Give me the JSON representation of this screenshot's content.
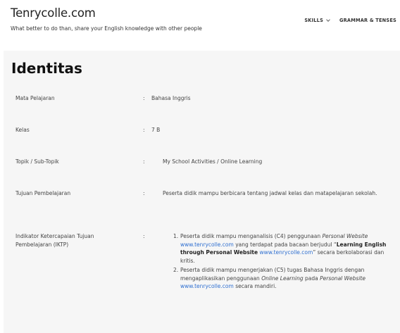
{
  "header": {
    "site_title": "Tenrycolle.com",
    "tagline": "What better to do than, share your English knowledge with other people",
    "nav": [
      {
        "label": "SKILLS"
      },
      {
        "label": "GRAMMAR & TENSES"
      }
    ]
  },
  "main": {
    "heading": "Identitas",
    "separator": ":",
    "rows": [
      {
        "label": "Mata Pelajaran",
        "value": "Bahasa Inggris"
      },
      {
        "label": "Kelas",
        "value": "7 B"
      },
      {
        "label": "Topik / Sub-Topik",
        "value": "My School Activities / Online Learning"
      },
      {
        "label": "Tujuan Pembelajaran",
        "value": "Peserta didik mampu berbicara tentang jadwal kelas dan matapelajaran sekolah."
      },
      {
        "label": "Indikator Ketercapaian Tujuan Pembelajaran (IKTP)"
      }
    ],
    "iktp": [
      {
        "num": "1.",
        "p1": "Peserta didik mampu menganalisis  (C4) penggunaan ",
        "i1": "Personal Website",
        "p2": " ",
        "link1": "www.tenrycolle.com",
        "p3": " yang terdapat pada bacaan berjudul “",
        "bold": "Learning English through Personal Website",
        "p4": " ",
        "link2": "www.tenrycolle.com",
        "p5": "” secara berkolaborasi dan kritis."
      },
      {
        "num": "2.",
        "p1": "Peserta didik mampu mengerjakan (C5) tugas Bahasa Inggris dengan mengaplikasikan penggunaan ",
        "i1": "Online Learning",
        "p2": " pada ",
        "i2": "Personal Website",
        "p3": " ",
        "link1": "www.tenrycolle.com",
        "p4": " secara mandiri."
      }
    ]
  },
  "colors": {
    "link": "#2f6fd0",
    "panel_bg": "#f6f6f6"
  },
  "icons": {
    "nav_dropdown": "chevron-down-icon"
  }
}
